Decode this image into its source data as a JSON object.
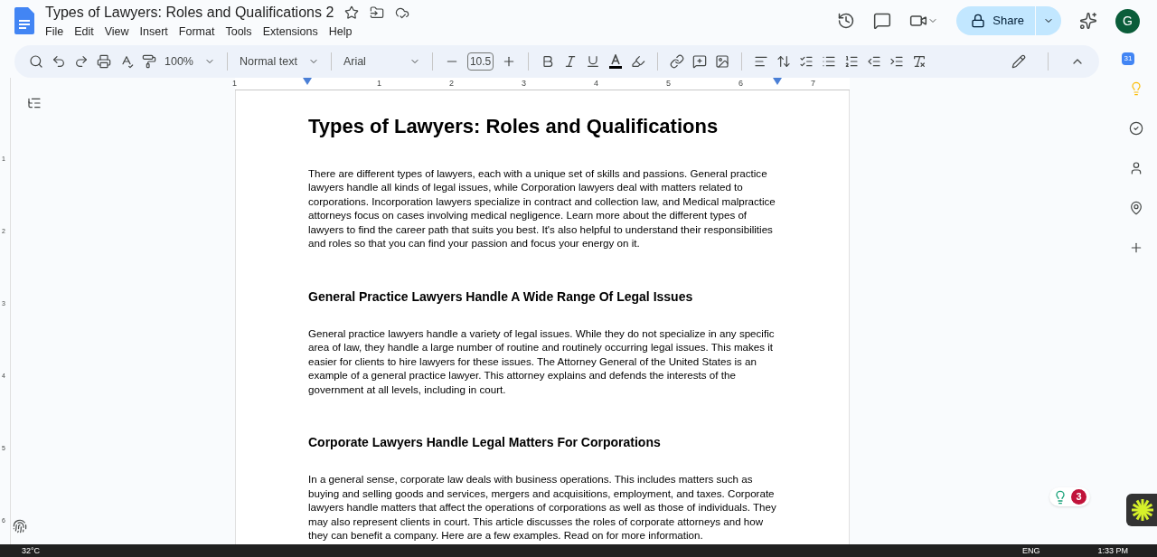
{
  "document_title": "Types of Lawyers: Roles and Qualifications 2",
  "menu": [
    "File",
    "Edit",
    "View",
    "Insert",
    "Format",
    "Tools",
    "Extensions",
    "Help"
  ],
  "share_button": "Share",
  "avatar": "G",
  "toolbar": {
    "zoom": "100%",
    "style": "Normal text",
    "font": "Arial",
    "font_size": "10.5"
  },
  "ruler": {
    "labels": [
      "1",
      "1",
      "2",
      "3",
      "4",
      "5",
      "6",
      "7"
    ]
  },
  "vertical_ruler": {
    "labels": [
      "1",
      "2",
      "3",
      "4",
      "5",
      "6"
    ]
  },
  "side_panel": {
    "calendar_day": "31"
  },
  "document": [
    {
      "kind": "title",
      "text": "Types of Lawyers: Roles and Qualifications"
    },
    {
      "kind": "paragraph",
      "text": "There are different types of lawyers, each with a unique set of skills and passions. General practice lawyers handle all kinds of legal issues, while Corporation lawyers deal with matters related to corporations. Incorporation lawyers specialize in contract and collection law, and Medical malpractice attorneys focus on cases involving medical negligence. Learn more about the different types of lawyers to find the career path that suits you best. It's also helpful to understand their responsibilities and roles so that you can find your passion and focus your energy on it."
    },
    {
      "kind": "heading",
      "text": "General Practice Lawyers Handle A Wide Range Of Legal Issues"
    },
    {
      "kind": "paragraph",
      "text": "General practice lawyers handle a variety of legal issues. While they do not specialize in any specific area of law, they handle a large number of routine and routinely occurring legal issues. This makes it easier for clients to hire lawyers for these issues. The Attorney General of the United States is an example of a general practice lawyer. This attorney explains and defends the interests of the government at all levels, including in court."
    },
    {
      "kind": "heading",
      "text": "Corporate Lawyers Handle Legal Matters For Corporations"
    },
    {
      "kind": "paragraph",
      "text": "In a general sense, corporate law deals with business operations. This includes matters such as buying and selling goods and services, mergers and acquisitions, employment, and taxes. Corporate lawyers handle matters that affect the operations of corporations as well as those of individuals. They may also represent clients in court. This article discusses the roles of corporate attorneys and how they can benefit a company. Here are a few examples. Read on for more information."
    }
  ],
  "suggestions_badge": "3",
  "taskbar": {
    "weather": "32°C",
    "language": "ENG",
    "time": "1:33 PM"
  }
}
